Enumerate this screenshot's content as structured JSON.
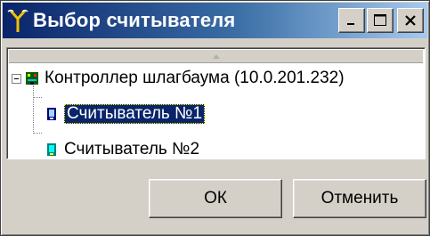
{
  "window": {
    "title": "Выбор считывателя",
    "icon": "reader-antenna-icon"
  },
  "titlebar_buttons": [
    "minimize",
    "maximize",
    "close"
  ],
  "tree": {
    "root": {
      "label": "Контроллер шлагбаума (10.0.201.232)",
      "icon": "controller-icon",
      "expanded": true
    },
    "children": [
      {
        "label": "Считыватель №1",
        "icon": "reader-icon",
        "selected": true
      },
      {
        "label": "Считыватель №2",
        "icon": "reader-icon",
        "selected": false
      }
    ]
  },
  "buttons": {
    "ok": "ОК",
    "cancel": "Отменить"
  },
  "colors": {
    "title_gradient_start": "#0a246a",
    "title_gradient_end": "#a6caf0",
    "selection": "#0a246a",
    "face": "#d4d0c8"
  }
}
